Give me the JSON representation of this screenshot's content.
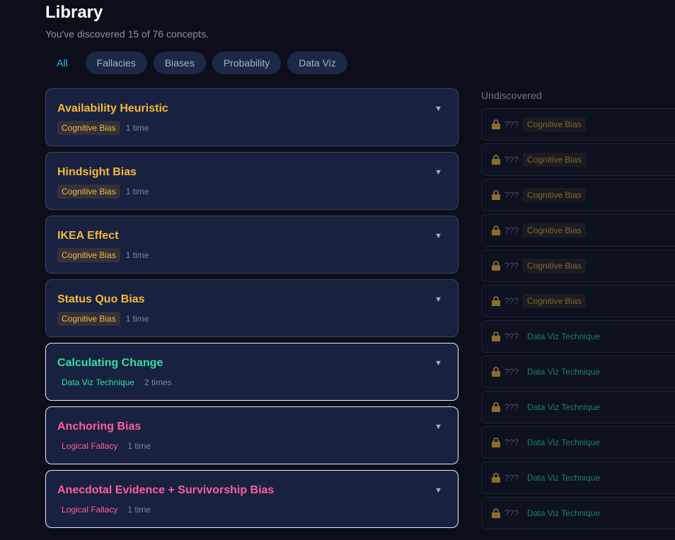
{
  "header": {
    "title": "Library",
    "subtitle": "You've discovered 15 of 76 concepts."
  },
  "filters": [
    {
      "label": "All",
      "active": true
    },
    {
      "label": "Fallacies",
      "active": false
    },
    {
      "label": "Biases",
      "active": false
    },
    {
      "label": "Probability",
      "active": false
    },
    {
      "label": "Data Viz",
      "active": false
    }
  ],
  "concepts": [
    {
      "title": "Availability Heuristic",
      "tag": "Cognitive Bias",
      "count": "1 time",
      "kind": "bias",
      "highlighted": false
    },
    {
      "title": "Hindsight Bias",
      "tag": "Cognitive Bias",
      "count": "1 time",
      "kind": "bias",
      "highlighted": false
    },
    {
      "title": "IKEA Effect",
      "tag": "Cognitive Bias",
      "count": "1 time",
      "kind": "bias",
      "highlighted": false
    },
    {
      "title": "Status Quo Bias",
      "tag": "Cognitive Bias",
      "count": "1 time",
      "kind": "bias",
      "highlighted": false
    },
    {
      "title": "Calculating Change",
      "tag": "Data Viz Technique",
      "count": "2 times",
      "kind": "viz",
      "highlighted": true
    },
    {
      "title": "Anchoring Bias",
      "tag": "Logical Fallacy",
      "count": "1 time",
      "kind": "fal",
      "highlighted": true
    },
    {
      "title": "Anecdotal Evidence + Survivorship Bias",
      "tag": "Logical Fallacy",
      "count": "1 time",
      "kind": "fal",
      "highlighted": true
    }
  ],
  "expand_icon": "chevron-down-icon",
  "undiscovered": {
    "heading": "Undiscovered",
    "placeholder": "???",
    "items": [
      {
        "tag": "Cognitive Bias",
        "kind": "bias"
      },
      {
        "tag": "Cognitive Bias",
        "kind": "bias"
      },
      {
        "tag": "Cognitive Bias",
        "kind": "bias"
      },
      {
        "tag": "Cognitive Bias",
        "kind": "bias"
      },
      {
        "tag": "Cognitive Bias",
        "kind": "bias"
      },
      {
        "tag": "Cognitive Bias",
        "kind": "bias"
      },
      {
        "tag": "Data Viz Technique",
        "kind": "viz"
      },
      {
        "tag": "Data Viz Technique",
        "kind": "viz"
      },
      {
        "tag": "Data Viz Technique",
        "kind": "viz"
      },
      {
        "tag": "Data Viz Technique",
        "kind": "viz"
      },
      {
        "tag": "Data Viz Technique",
        "kind": "viz"
      },
      {
        "tag": "Data Viz Technique",
        "kind": "viz"
      }
    ]
  },
  "colors": {
    "background": "#0c0f1a",
    "card": "#18213f",
    "bias": "#f5b83a",
    "viz": "#2ee0a1",
    "fallacy": "#ff5d9e",
    "active_filter": "#3fb8ff"
  }
}
